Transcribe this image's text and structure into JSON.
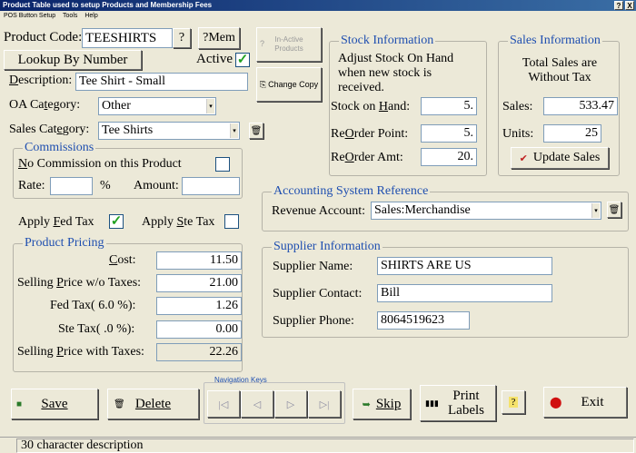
{
  "window": {
    "title": "Product Table used to setup Products and Membership Fees",
    "controls": [
      "?",
      "X"
    ]
  },
  "menu": [
    "POS Button Setup",
    "Tools",
    "Help"
  ],
  "product": {
    "code_label": "Product Code:",
    "code_value": "TEESHIRTS",
    "help_button": "?",
    "mem_button": "?Mem",
    "lookup_button": "Lookup By Number",
    "active_label": "Active",
    "active_checked": true,
    "description_label": "Description:",
    "description_value": "Tee Shirt - Small",
    "oa_category_label": "OA Category:",
    "oa_category_value": "Other",
    "sales_category_label": "Sales Category:",
    "sales_category_value": "Tee Shirts",
    "inactive_button": [
      "In-Active",
      "Products"
    ],
    "change_copy_button": "Change Copy"
  },
  "commissions": {
    "legend": "Commissions",
    "no_commission_label": "No Commission on this Product",
    "no_commission_checked": false,
    "rate_label": "Rate:",
    "rate_value": "",
    "percent_sign": "%",
    "amount_label": "Amount:",
    "amount_value": ""
  },
  "taxes": {
    "fed_tax_label": "Apply Fed Tax",
    "fed_tax_checked": true,
    "ste_tax_label": "Apply Ste Tax",
    "ste_tax_checked": false
  },
  "pricing": {
    "legend": "Product Pricing",
    "cost_label": "Cost:",
    "cost_value": "11.50",
    "selling_wo_label": "Selling Price w/o Taxes:",
    "selling_wo_value": "21.00",
    "fed_tax_label": "Fed Tax( 6.0  %):",
    "fed_tax_value": "1.26",
    "ste_tax_label": "Ste Tax(  .0  %):",
    "ste_tax_value": "0.00",
    "selling_with_label": "Selling Price with Taxes:",
    "selling_with_value": "22.26"
  },
  "stock": {
    "legend": "Stock Information",
    "note": "Adjust Stock On Hand when new stock is received.",
    "on_hand_label": "Stock on Hand:",
    "on_hand_value": "5.",
    "reorder_point_label": "ReOrder Point:",
    "reorder_point_value": "5.",
    "reorder_amt_label": "ReOrder Amt:",
    "reorder_amt_value": "20."
  },
  "sales_info": {
    "legend": "Sales Information",
    "note": "Total Sales are Without Tax",
    "sales_label": "Sales:",
    "sales_value": "533.47",
    "units_label": "Units:",
    "units_value": "25",
    "update_button": "Update Sales"
  },
  "accounting": {
    "legend": "Accounting System Reference",
    "revenue_label": "Revenue Account:",
    "revenue_value": "Sales:Merchandise"
  },
  "supplier": {
    "legend": "Supplier Information",
    "name_label": "Supplier Name:",
    "name_value": "SHIRTS ARE US",
    "contact_label": "Supplier Contact:",
    "contact_value": "Bill",
    "phone_label": "Supplier Phone:",
    "phone_value": "8064519623"
  },
  "bottom": {
    "save": "Save",
    "delete": "Delete",
    "nav_label": "Navigation Keys",
    "skip": "Skip",
    "print_labels": "Print Labels",
    "help": "?",
    "exit": "Exit"
  },
  "status": {
    "message": "30 character description"
  },
  "colors": {
    "legend": "#1f4fb0",
    "window_bg": "#ece9d8",
    "check_green": "#21a121",
    "exit_icon": "#d01010"
  }
}
